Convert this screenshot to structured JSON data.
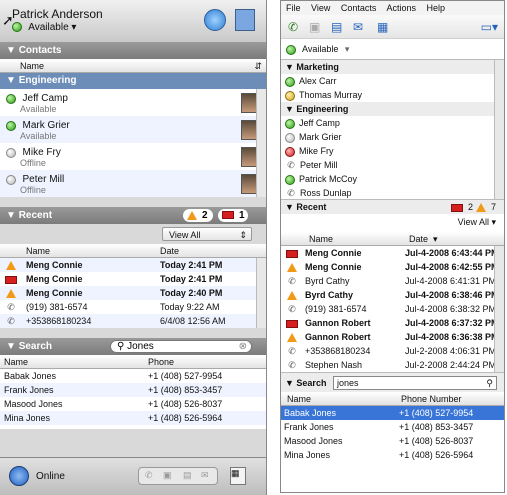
{
  "left": {
    "user_name": "Patrick Anderson",
    "status": "Available ▾",
    "contacts_header": "Contacts",
    "name_col": "Name",
    "engineering": "Engineering",
    "contacts": [
      {
        "name": "Jeff Camp",
        "status": "Available",
        "dot": "green"
      },
      {
        "name": "Mark Grier",
        "status": "Available",
        "dot": "green"
      },
      {
        "name": "Mike Fry",
        "status": "Offline",
        "dot": "grey"
      },
      {
        "name": "Peter Mill",
        "status": "Offline",
        "dot": "grey"
      }
    ],
    "recent_header": "Recent",
    "badge_warn": "2",
    "badge_mail": "1",
    "view_all": "View All",
    "recent_cols": [
      "Name",
      "Date"
    ],
    "recent": [
      {
        "icon": "warn",
        "name": "Meng Connie",
        "date": "Today 2:41 PM",
        "bold": true
      },
      {
        "icon": "mail",
        "name": "Meng Connie",
        "date": "Today 2:41 PM",
        "bold": true
      },
      {
        "icon": "warn",
        "name": "Meng Connie",
        "date": "Today 2:40 PM",
        "bold": true
      },
      {
        "icon": "phone",
        "name": "(919) 381-6574",
        "date": "Today 9:22 AM",
        "bold": false
      },
      {
        "icon": "phone",
        "name": "+353868180234",
        "date": "6/4/08 12:56 AM",
        "bold": false
      }
    ],
    "search_header": "Search",
    "search_value": "Jones",
    "search_cols": [
      "Name",
      "Phone"
    ],
    "search": [
      {
        "name": "Babak Jones",
        "phone": "+1 (408) 527-9954"
      },
      {
        "name": "Frank Jones",
        "phone": "+1 (408) 853-3457"
      },
      {
        "name": "Masood Jones",
        "phone": "+1 (408) 526-8037"
      },
      {
        "name": "Mina Jones",
        "phone": "+1 (408) 526-5964"
      }
    ],
    "online": "Online"
  },
  "right": {
    "menu": [
      "File",
      "View",
      "Contacts",
      "Actions",
      "Help"
    ],
    "available": "Available",
    "marketing": "Marketing",
    "marketing_contacts": [
      {
        "name": "Alex Carr",
        "dot": "green"
      },
      {
        "name": "Thomas Murray",
        "dot": "yellow"
      }
    ],
    "engineering": "Engineering",
    "engineering_contacts": [
      {
        "name": "Jeff Camp",
        "dot": "green"
      },
      {
        "name": "Mark Grier",
        "dot": "grey"
      },
      {
        "name": "Mike Fry",
        "dot": "red"
      },
      {
        "name": "Peter Mill",
        "dot": "phone"
      },
      {
        "name": "Patrick McCoy",
        "dot": "green"
      },
      {
        "name": "Ross Dunlap",
        "dot": "phone"
      }
    ],
    "recent_header": "Recent",
    "badge_mail": "2",
    "badge_warn": "7",
    "view_all": "View All",
    "recent_cols": [
      "Name",
      "Date"
    ],
    "recent": [
      {
        "icon": "mail",
        "name": "Meng Connie",
        "date": "Jul-4-2008 6:43:44 PM",
        "bold": true
      },
      {
        "icon": "warn",
        "name": "Meng Connie",
        "date": "Jul-4-2008 6:42:55 PM",
        "bold": true
      },
      {
        "icon": "phone",
        "name": "Byrd Cathy",
        "date": "Jul-4-2008 6:41:31 PM",
        "bold": false
      },
      {
        "icon": "warn",
        "name": "Byrd Cathy",
        "date": "Jul-4-2008 6:38:46 PM",
        "bold": true
      },
      {
        "icon": "phone",
        "name": "(919) 381-6574",
        "date": "Jul-4-2008 6:38:32 PM",
        "bold": false
      },
      {
        "icon": "mail",
        "name": "Gannon Robert",
        "date": "Jul-4-2008 6:37:32 PM",
        "bold": true
      },
      {
        "icon": "warn",
        "name": "Gannon Robert",
        "date": "Jul-4-2008 6:36:38 PM",
        "bold": true
      },
      {
        "icon": "phone",
        "name": "+353868180234",
        "date": "Jul-2-2008 4:06:31 PM",
        "bold": false
      },
      {
        "icon": "phone",
        "name": "Stephen Nash",
        "date": "Jul-2-2008 2:44:24 PM",
        "bold": false
      }
    ],
    "search_header": "Search",
    "search_value": "jones",
    "search_cols": [
      "Name",
      "Phone Number"
    ],
    "search": [
      {
        "name": "Babak Jones",
        "phone": "+1 (408) 527-9954"
      },
      {
        "name": "Frank Jones",
        "phone": "+1 (408) 853-3457"
      },
      {
        "name": "Masood Jones",
        "phone": "+1 (408) 526-8037"
      },
      {
        "name": "Mina Jones",
        "phone": "+1 (408) 526-5964"
      }
    ]
  }
}
